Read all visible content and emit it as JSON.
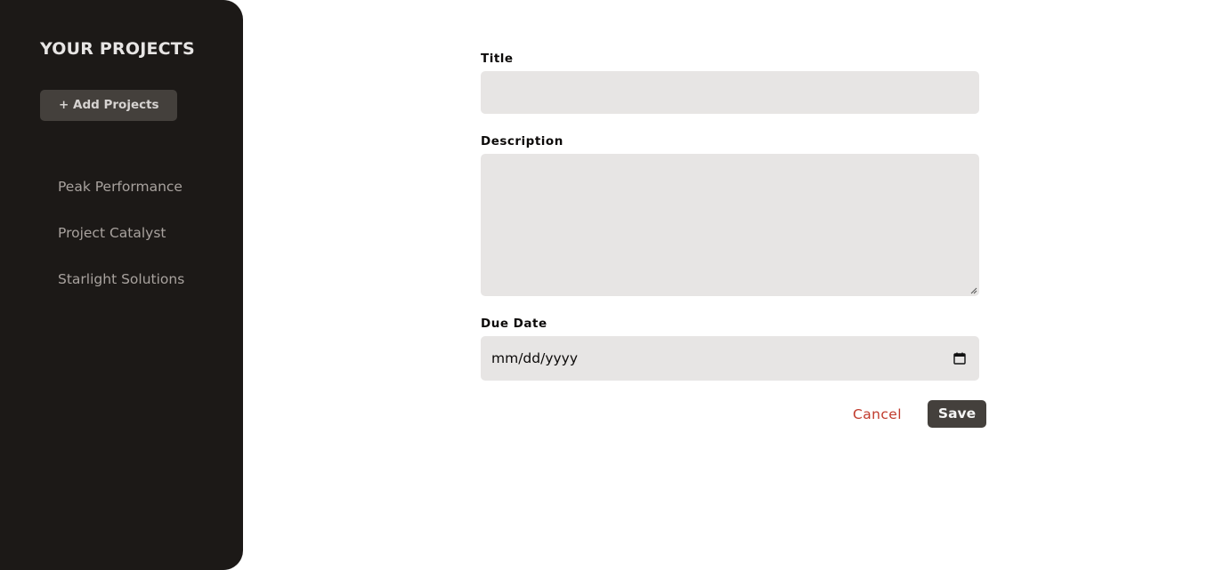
{
  "sidebar": {
    "title": "YOUR PROJECTS",
    "add_button_label": "+ Add Projects",
    "projects": [
      {
        "label": "Peak Performance"
      },
      {
        "label": "Project Catalyst"
      },
      {
        "label": "Starlight Solutions"
      }
    ]
  },
  "form": {
    "title_label": "Title",
    "title_value": "",
    "description_label": "Description",
    "description_value": "",
    "due_date_label": "Due Date",
    "due_date_placeholder": "mm/dd/yyyy",
    "cancel_label": "Cancel",
    "save_label": "Save"
  },
  "colors": {
    "sidebar_bg": "#1c1917",
    "input_bg": "#e7e5e4",
    "button_bg": "#44403c",
    "cancel_text": "#c0392b"
  },
  "icons": {
    "calendar": "calendar-icon",
    "resize": "resize-handle-icon"
  }
}
